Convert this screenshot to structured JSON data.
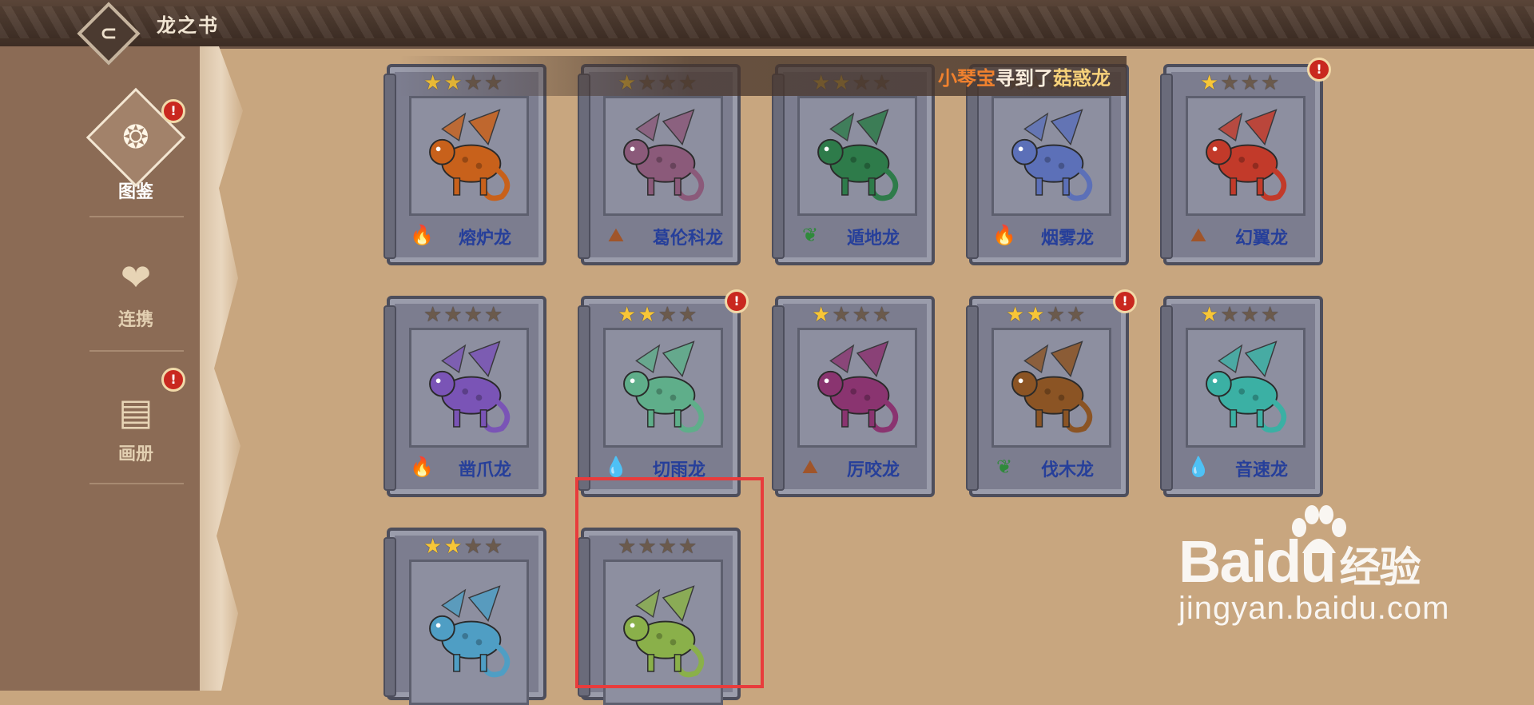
{
  "app": {
    "title": "龙之书",
    "back_glyph": "⊂"
  },
  "sidebar": {
    "items": [
      {
        "label": "图鉴",
        "icon": "scroll-icon",
        "glyph": "❂",
        "active": true,
        "alert": true
      },
      {
        "label": "连携",
        "icon": "heart-link-icon",
        "glyph": "❤",
        "active": false,
        "alert": false
      },
      {
        "label": "画册",
        "icon": "album-icon",
        "glyph": "▤",
        "active": false,
        "alert": true
      }
    ]
  },
  "notification": {
    "who": "小琴宝",
    "action": "寻到了",
    "dragon": "菇惑龙"
  },
  "badge": {
    "text": "!"
  },
  "dragons": [
    {
      "name": "熔炉龙",
      "stars": 2,
      "class": "fire-class-icon",
      "glyph": "🔥",
      "color": "#c8611b",
      "alert": false
    },
    {
      "name": "葛伦科龙",
      "stars": 1,
      "class": "boulder-class-icon",
      "glyph": "⛰",
      "color": "#8b5a7a",
      "alert": false
    },
    {
      "name": "遁地龙",
      "stars": 2,
      "class": "nature-class-icon",
      "glyph": "❦",
      "color": "#2e7b4a",
      "alert": false
    },
    {
      "name": "烟雾龙",
      "stars": 0,
      "class": "fire-class-icon",
      "glyph": "🔥",
      "color": "#5c70b8",
      "alert": false
    },
    {
      "name": "幻翼龙",
      "stars": 1,
      "class": "boulder-class-icon",
      "glyph": "⛰",
      "color": "#c23a2a",
      "alert": true
    },
    {
      "name": "凿爪龙",
      "stars": 0,
      "class": "fire-class-icon",
      "glyph": "🔥",
      "color": "#7a54b6",
      "alert": false
    },
    {
      "name": "切雨龙",
      "stars": 2,
      "class": "water-class-icon",
      "glyph": "💧",
      "color": "#5fae8a",
      "alert": true
    },
    {
      "name": "厉咬龙",
      "stars": 1,
      "class": "boulder-class-icon",
      "glyph": "⛰",
      "color": "#8a3470",
      "alert": false
    },
    {
      "name": "伐木龙",
      "stars": 2,
      "class": "nature-class-icon",
      "glyph": "❦",
      "color": "#8b5424",
      "alert": true
    },
    {
      "name": "音速龙",
      "stars": 1,
      "class": "water-class-icon",
      "glyph": "💧",
      "color": "#3bb0a4",
      "alert": false
    },
    {
      "name": "",
      "stars": 2,
      "class": "",
      "glyph": "",
      "color": "#4f9ec4",
      "alert": false
    },
    {
      "name": "",
      "stars": 0,
      "class": "",
      "glyph": "",
      "color": "#8ab04a",
      "alert": false
    }
  ],
  "watermark": {
    "logo": "Bai",
    "logo2": "du",
    "cn": "经验",
    "url": "jingyan.baidu.com"
  },
  "colors": {
    "accent_red": "#e83c3c",
    "star_on": "#f7c637",
    "name_blue": "#263f9a"
  }
}
